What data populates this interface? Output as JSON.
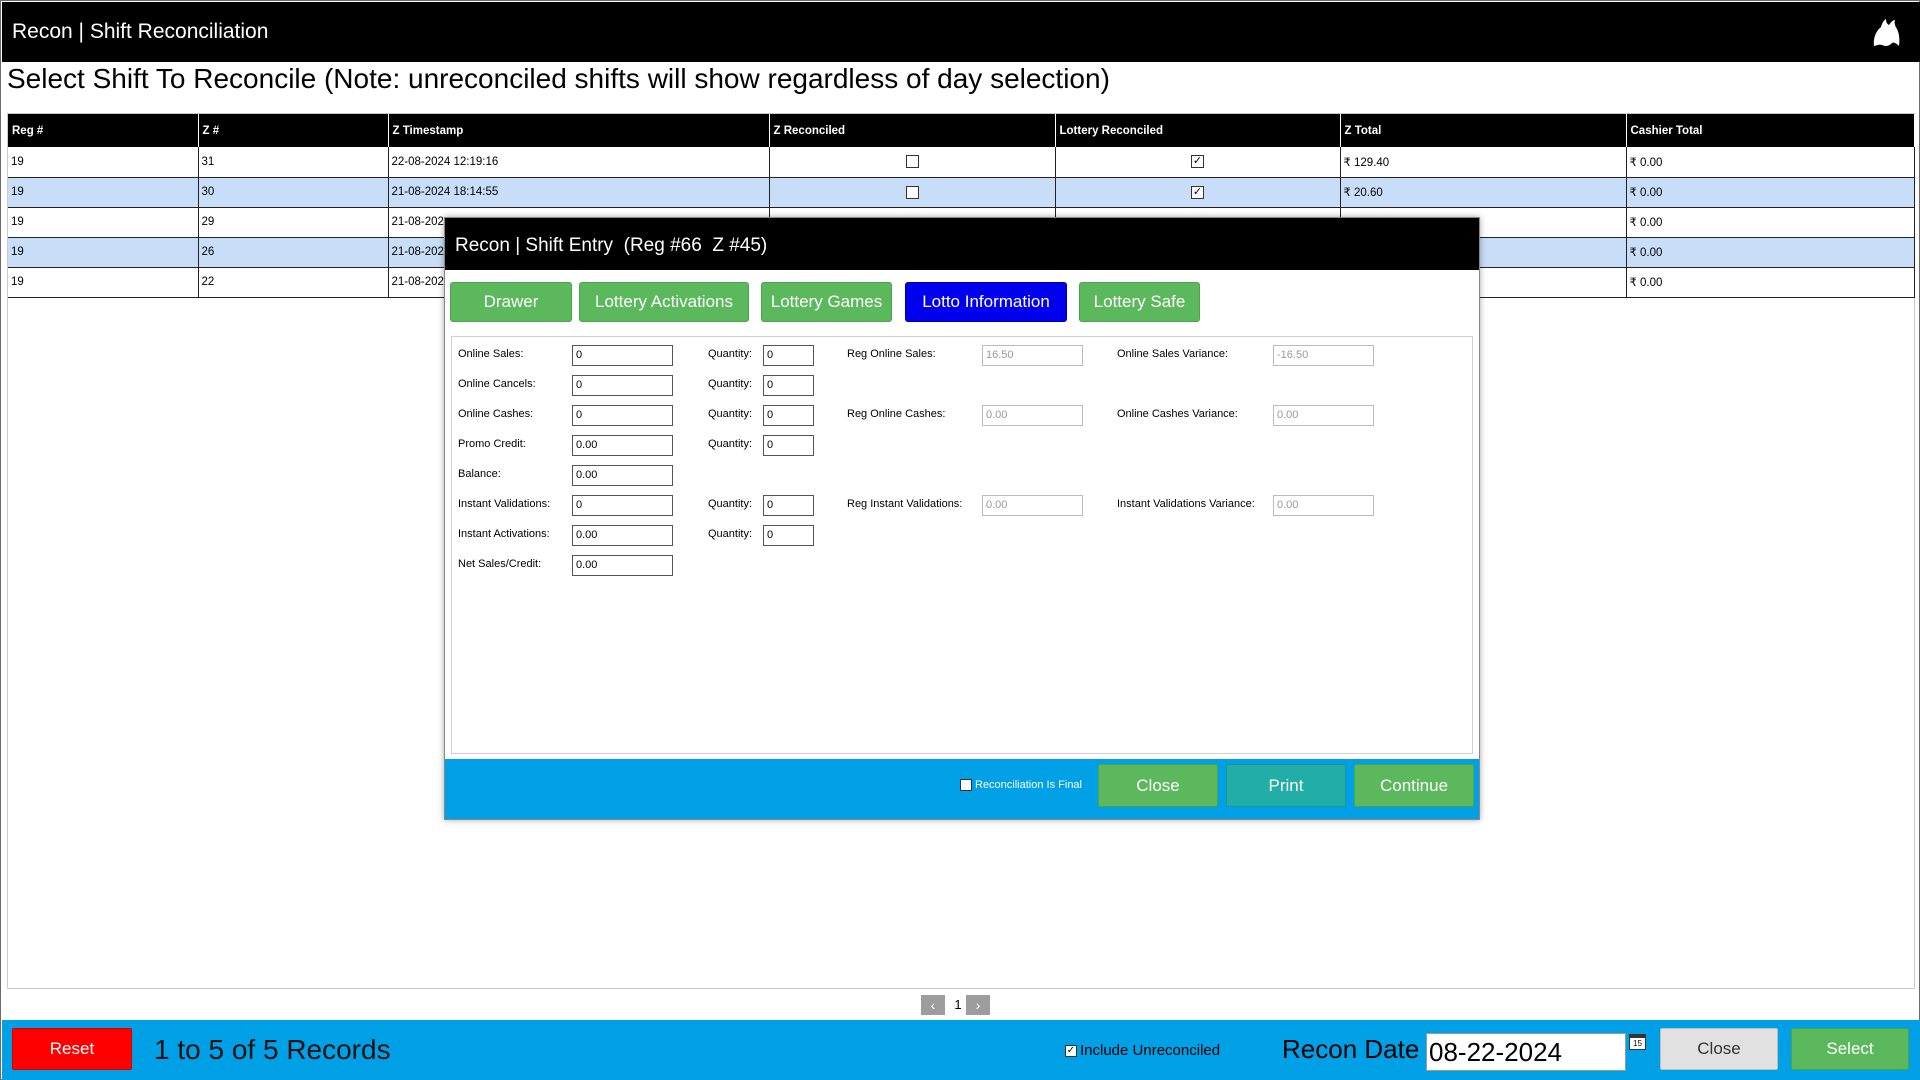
{
  "window": {
    "title": "Recon | Shift Reconciliation"
  },
  "heading": "Select Shift To Reconcile (Note: unreconciled shifts will show regardless of day selection)",
  "grid": {
    "columns": [
      "Reg #",
      "Z #",
      "Z Timestamp",
      "Z Reconciled",
      "Lottery Reconciled",
      "Z Total",
      "Cashier Total"
    ],
    "rows": [
      {
        "reg": "19",
        "z": "31",
        "ts": "22-08-2024 12:19:16",
        "z_rec": false,
        "lot_rec": true,
        "z_total": "₹ 129.40",
        "cashier_total": "₹ 0.00"
      },
      {
        "reg": "19",
        "z": "30",
        "ts": "21-08-2024 18:14:55",
        "z_rec": false,
        "lot_rec": true,
        "z_total": "₹ 20.60",
        "cashier_total": "₹ 0.00"
      },
      {
        "reg": "19",
        "z": "29",
        "ts": "21-08-202",
        "z_rec": null,
        "lot_rec": null,
        "z_total": "",
        "cashier_total": "₹ 0.00"
      },
      {
        "reg": "19",
        "z": "26",
        "ts": "21-08-202",
        "z_rec": null,
        "lot_rec": null,
        "z_total": "",
        "cashier_total": "₹ 0.00"
      },
      {
        "reg": "19",
        "z": "22",
        "ts": "21-08-202",
        "z_rec": null,
        "lot_rec": null,
        "z_total": "",
        "cashier_total": "₹ 0.00"
      }
    ]
  },
  "pager": {
    "prev": "‹",
    "page": "1",
    "next": "›"
  },
  "bottom": {
    "reset_label": "Reset",
    "records_text": "1 to 5 of 5 Records",
    "include_unreconciled_label": "Include Unreconciled",
    "include_unreconciled_checked": true,
    "recon_date_label": "Recon Date :",
    "recon_date_value": "08-22-2024",
    "calendar_day": "15",
    "close_label": "Close",
    "select_label": "Select"
  },
  "modal": {
    "title": "Recon | Shift Entry  (Reg #66  Z #45)",
    "tabs": [
      {
        "label": "Drawer",
        "active": false
      },
      {
        "label": "Lottery Activations",
        "active": false
      },
      {
        "label": "Lottery Games",
        "active": false
      },
      {
        "label": "Lotto Information",
        "active": true
      },
      {
        "label": "Lottery Safe",
        "active": false
      }
    ],
    "fields": {
      "online_sales": {
        "label": "Online Sales:",
        "value": "0"
      },
      "online_cancels": {
        "label": "Online Cancels:",
        "value": "0"
      },
      "online_cashes": {
        "label": "Online Cashes:",
        "value": "0"
      },
      "promo_credit": {
        "label": "Promo Credit:",
        "value": "0.00"
      },
      "balance": {
        "label": "Balance:",
        "value": "0.00"
      },
      "instant_validations": {
        "label": "Instant Validations:",
        "value": "0"
      },
      "instant_activations": {
        "label": "Instant Activations:",
        "value": "0.00"
      },
      "net_sales_credit": {
        "label": "Net Sales/Credit:",
        "value": "0.00"
      },
      "qty_label": "Quantity:",
      "qty_online_sales": "0",
      "qty_online_cancels": "0",
      "qty_online_cashes": "0",
      "qty_promo_credit": "0",
      "qty_instant_validations": "0",
      "qty_instant_activations": "0",
      "reg_online_sales": {
        "label": "Reg Online Sales:",
        "value": "16.50"
      },
      "reg_online_cashes": {
        "label": "Reg Online Cashes:",
        "value": "0.00"
      },
      "reg_instant_validations": {
        "label": "Reg Instant Validations:",
        "value": "0.00"
      },
      "online_sales_variance": {
        "label": "Online Sales Variance:",
        "value": "-16.50"
      },
      "online_cashes_variance": {
        "label": "Online Cashes Variance:",
        "value": "0.00"
      },
      "instant_validations_variance": {
        "label": "Instant Validations Variance:",
        "value": "0.00"
      }
    },
    "footer": {
      "final_label": "Reconciliation Is Final",
      "final_checked": false,
      "close_label": "Close",
      "print_label": "Print",
      "continue_label": "Continue"
    }
  },
  "colors": {
    "accent_blue": "#00a0e6",
    "row_highlight": "#c8def8",
    "tab_green": "#5cb85c",
    "tab_active": "#0000ee",
    "reset_red": "#ff0000",
    "print_teal": "#23ada7"
  }
}
